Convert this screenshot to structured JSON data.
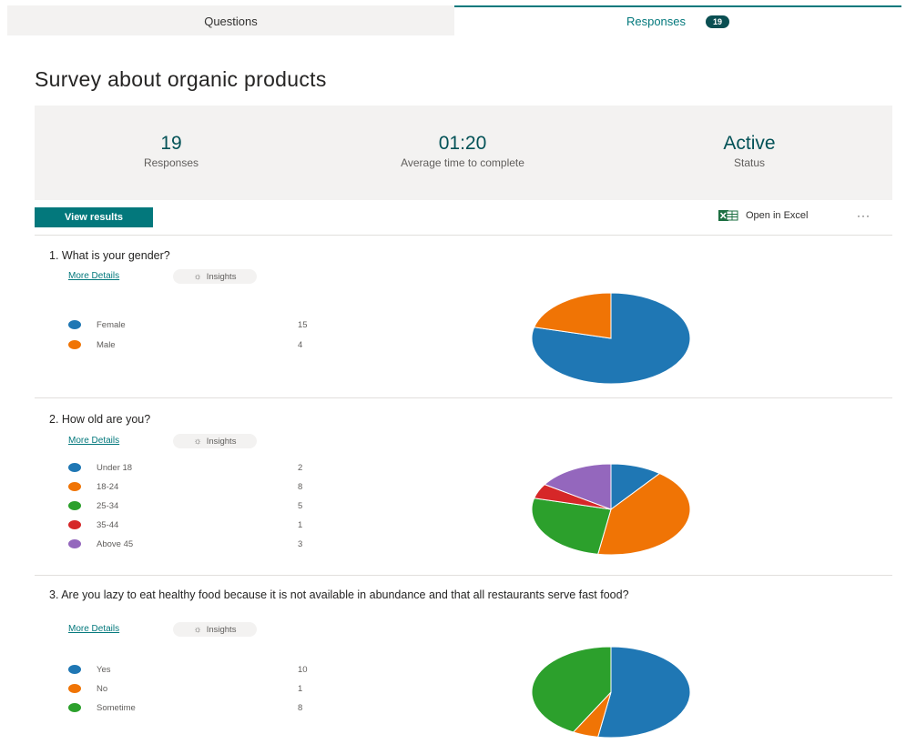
{
  "tabs": [
    {
      "label": "Questions"
    },
    {
      "label": "Responses",
      "badge": "19"
    }
  ],
  "title": "Survey about organic products",
  "summary": {
    "responses": {
      "value": "19",
      "label": "Responses"
    },
    "avg_time": {
      "value": "01:20",
      "label": "Average time to complete"
    },
    "status": {
      "value": "Active",
      "label": "Status"
    }
  },
  "toolbar": {
    "view_results": "View results",
    "open_excel": "Open in Excel",
    "more": "···"
  },
  "colors": {
    "accent": "#03787c",
    "series": [
      "#1f77b4",
      "#f07405",
      "#2ca02c",
      "#d62728",
      "#9467bd"
    ]
  },
  "questions": [
    {
      "title": "1.  What is your gender?",
      "more_details": "More Details",
      "insights": "Insights",
      "options": [
        {
          "label": "Female",
          "count": "15"
        },
        {
          "label": "Male",
          "count": "4"
        }
      ]
    },
    {
      "title": "2.  How old are you?",
      "more_details": "More Details",
      "insights": "Insights",
      "options": [
        {
          "label": "Under 18",
          "count": "2"
        },
        {
          "label": "18-24",
          "count": "8"
        },
        {
          "label": "25-34",
          "count": "5"
        },
        {
          "label": "35-44",
          "count": "1"
        },
        {
          "label": "Above 45",
          "count": "3"
        }
      ]
    },
    {
      "title": "3.  Are you lazy to eat healthy food because it is not available in abundance and that all restaurants serve fast food?",
      "more_details": "More Details",
      "insights": "Insights",
      "options": [
        {
          "label": "Yes",
          "count": "10"
        },
        {
          "label": "No",
          "count": "1"
        },
        {
          "label": "Sometime",
          "count": "8"
        }
      ]
    }
  ],
  "chart_data": [
    {
      "type": "pie",
      "categories": [
        "Female",
        "Male"
      ],
      "values": [
        15,
        4
      ]
    },
    {
      "type": "pie",
      "categories": [
        "Under 18",
        "18-24",
        "25-34",
        "35-44",
        "Above 45"
      ],
      "values": [
        2,
        8,
        5,
        1,
        3
      ]
    },
    {
      "type": "pie",
      "categories": [
        "Yes",
        "No",
        "Sometime"
      ],
      "values": [
        10,
        1,
        8
      ]
    }
  ]
}
